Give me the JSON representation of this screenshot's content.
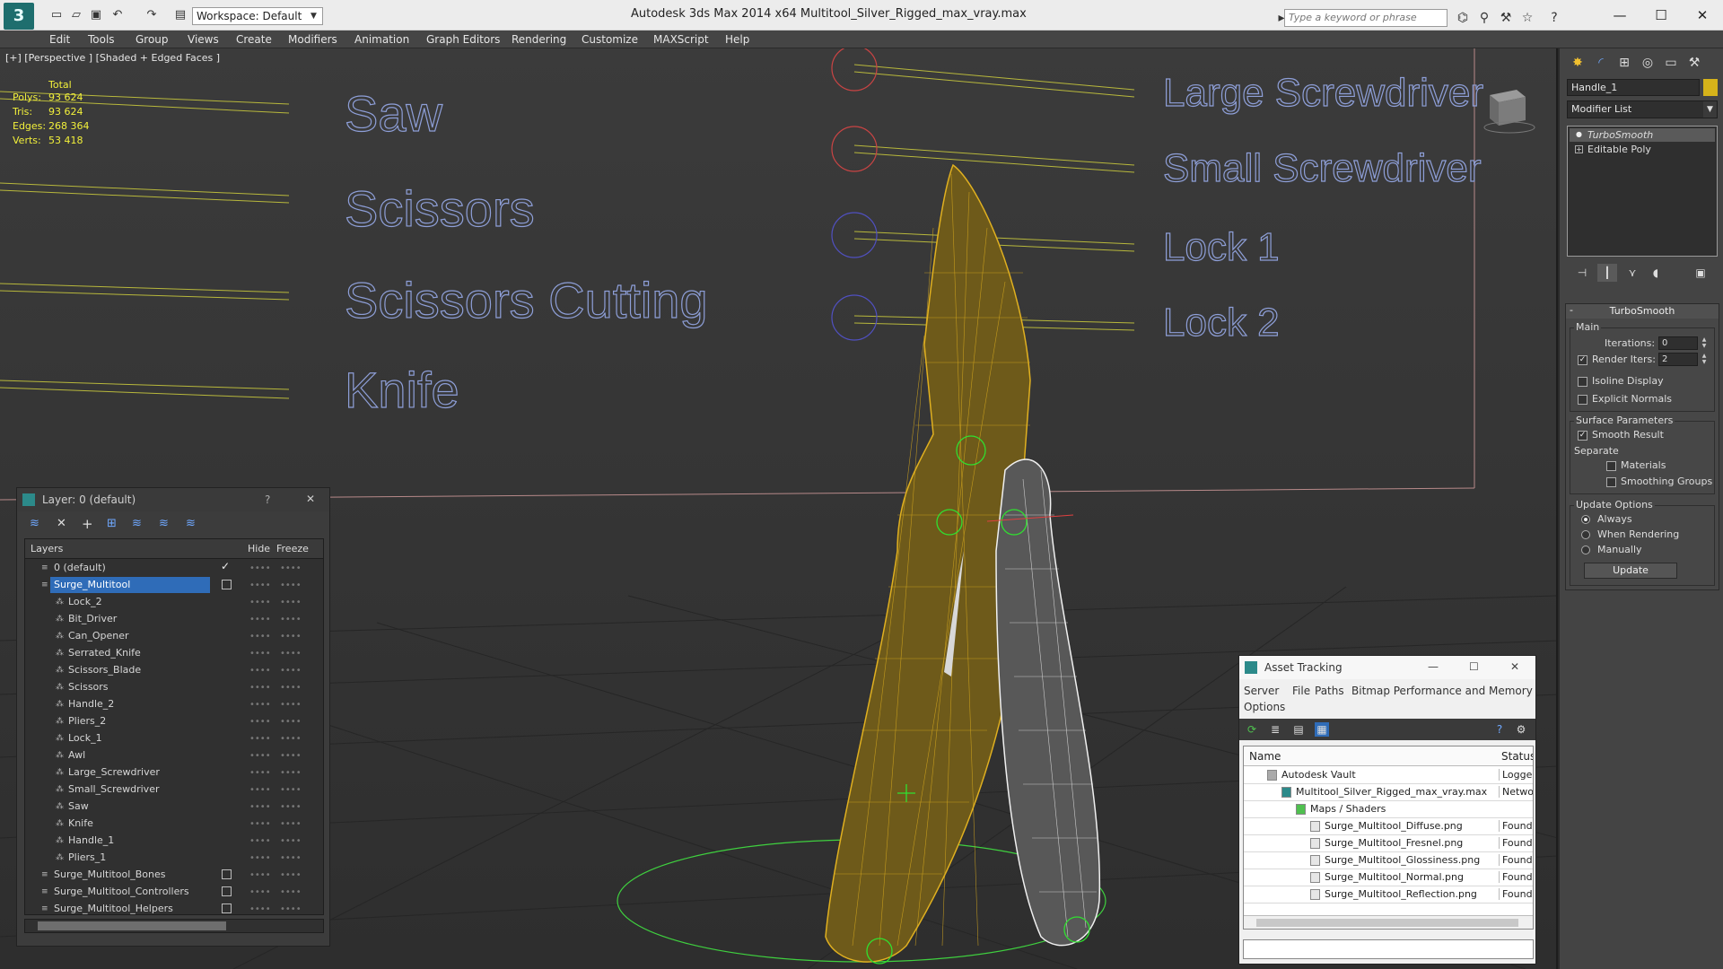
{
  "app": {
    "logo": "3",
    "title": "Autodesk 3ds Max  2014 x64      Multitool_Silver_Rigged_max_vray.max",
    "workspace": "Workspace: Default",
    "search_placeholder": "Type a keyword or phrase"
  },
  "menu": [
    "Edit",
    "Tools",
    "Group",
    "Views",
    "Create",
    "Modifiers",
    "Animation",
    "Graph Editors",
    "Rendering",
    "Customize",
    "MAXScript",
    "Help"
  ],
  "viewport": {
    "label": "[+] [Perspective ] [Shaded + Edged Faces ]",
    "stats": {
      "header": "Total",
      "rows": [
        {
          "key": "Polys:",
          "value": "93 624"
        },
        {
          "key": "Tris:",
          "value": "93 624"
        },
        {
          "key": "Edges:",
          "value": "268 364"
        },
        {
          "key": "Verts:",
          "value": "53 418"
        }
      ]
    },
    "left_labels": [
      "Saw",
      "Scissors",
      "Scissors Cutting",
      "Knife"
    ],
    "right_labels": [
      "Large Screwdriver",
      "Small Screwdriver",
      "Lock 1",
      "Lock 2"
    ]
  },
  "layer_explorer": {
    "title": "Layer: 0 (default)",
    "help": "?",
    "close": "✕",
    "columns": [
      "Layers",
      "Hide",
      "Freeze"
    ],
    "layers": [
      {
        "name": "0 (default)",
        "indent": 1,
        "current": true
      },
      {
        "name": "Surge_Multitool",
        "indent": 1,
        "selected": true,
        "check": true
      },
      {
        "name": "Lock_2",
        "indent": 2
      },
      {
        "name": "Bit_Driver",
        "indent": 2
      },
      {
        "name": "Can_Opener",
        "indent": 2
      },
      {
        "name": "Serrated_Knife",
        "indent": 2
      },
      {
        "name": "Scissors_Blade",
        "indent": 2
      },
      {
        "name": "Scissors",
        "indent": 2
      },
      {
        "name": "Handle_2",
        "indent": 2
      },
      {
        "name": "Pliers_2",
        "indent": 2
      },
      {
        "name": "Lock_1",
        "indent": 2
      },
      {
        "name": "Awl",
        "indent": 2
      },
      {
        "name": "Large_Screwdriver",
        "indent": 2
      },
      {
        "name": "Small_Screwdriver",
        "indent": 2
      },
      {
        "name": "Saw",
        "indent": 2
      },
      {
        "name": "Knife",
        "indent": 2
      },
      {
        "name": "Handle_1",
        "indent": 2
      },
      {
        "name": "Pliers_1",
        "indent": 2
      },
      {
        "name": "Surge_Multitool_Bones",
        "indent": 1,
        "check": true
      },
      {
        "name": "Surge_Multitool_Controllers",
        "indent": 1,
        "check": true
      },
      {
        "name": "Surge_Multitool_Helpers",
        "indent": 1,
        "check": true
      }
    ]
  },
  "asset_tracking": {
    "title": "Asset Tracking",
    "menu": [
      "Server",
      "File",
      "Paths",
      "Bitmap Performance and Memory",
      "Options"
    ],
    "columns": [
      "Name",
      "Status"
    ],
    "rows": [
      {
        "name": "Autodesk Vault",
        "status": "Logged",
        "indent": 0
      },
      {
        "name": "Multitool_Silver_Rigged_max_vray.max",
        "status": "Networ",
        "indent": 1
      },
      {
        "name": "Maps / Shaders",
        "status": "",
        "indent": 2
      },
      {
        "name": "Surge_Multitool_Diffuse.png",
        "status": "Found",
        "indent": 3
      },
      {
        "name": "Surge_Multitool_Fresnel.png",
        "status": "Found",
        "indent": 3
      },
      {
        "name": "Surge_Multitool_Glossiness.png",
        "status": "Found",
        "indent": 3
      },
      {
        "name": "Surge_Multitool_Normal.png",
        "status": "Found",
        "indent": 3
      },
      {
        "name": "Surge_Multitool_Reflection.png",
        "status": "Found",
        "indent": 3
      }
    ]
  },
  "command_panel": {
    "object_name": "Handle_1",
    "object_color": "#d6b31a",
    "modifier_list": "Modifier List",
    "stack": [
      {
        "name": "TurboSmooth",
        "active": true
      },
      {
        "name": "Editable Poly",
        "active": false
      }
    ],
    "rollout": {
      "title": "TurboSmooth",
      "main_group": "Main",
      "iterations_label": "Iterations:",
      "iterations": "0",
      "render_iters_label": "Render Iters:",
      "render_iters": "2",
      "render_iters_checked": true,
      "isoline_label": "Isoline Display",
      "explicit_label": "Explicit Normals",
      "surface_group": "Surface Parameters",
      "smooth_result_label": "Smooth Result",
      "separate_label": "Separate",
      "materials_label": "Materials",
      "smoothing_label": "Smoothing Groups",
      "update_group": "Update Options",
      "always_label": "Always",
      "when_rendering_label": "When Rendering",
      "manually_label": "Manually",
      "update_button": "Update"
    }
  }
}
